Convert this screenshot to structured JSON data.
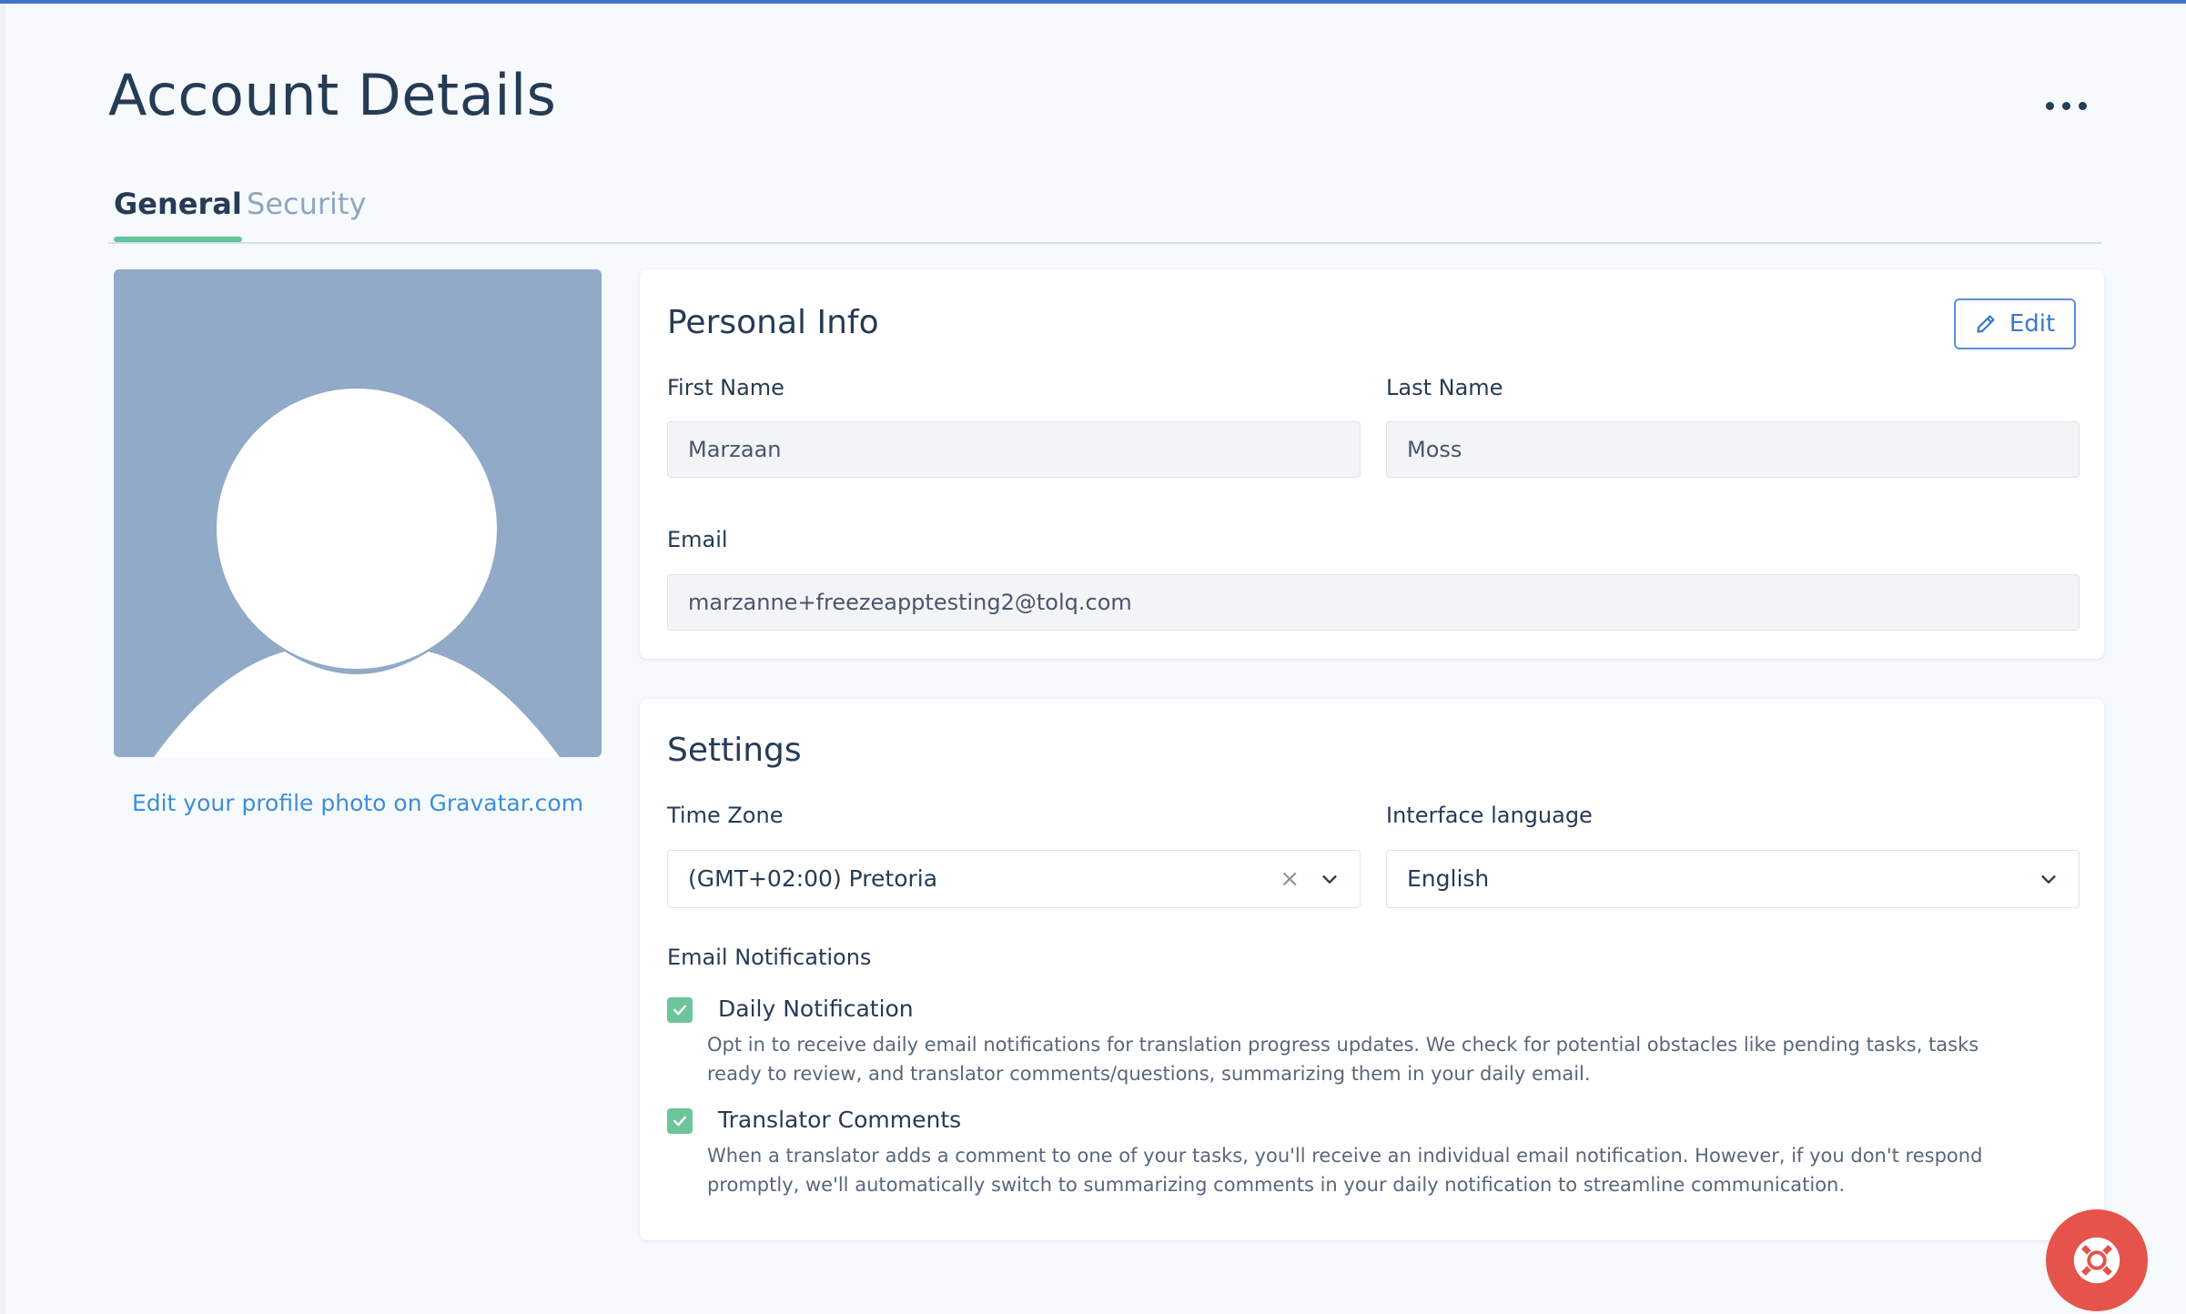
{
  "page": {
    "title": "Account Details",
    "more_icon": "more-horizontal-icon"
  },
  "tabs": [
    {
      "label": "General",
      "active": true
    },
    {
      "label": "Security",
      "active": false
    }
  ],
  "profile": {
    "avatar_icon": "default-user-avatar-icon",
    "gravatar_link": "Edit your profile photo on Gravatar.com"
  },
  "personal_info": {
    "title": "Personal Info",
    "edit_label": "Edit",
    "edit_icon": "pencil-icon",
    "first_name_label": "First Name",
    "first_name": "Marzaan",
    "last_name_label": "Last Name",
    "last_name": "Moss",
    "email_label": "Email",
    "email": "marzanne+freezeapptesting2@tolq.com"
  },
  "settings": {
    "title": "Settings",
    "timezone_label": "Time Zone",
    "timezone": "(GMT+02:00) Pretoria",
    "clear_glyph": "×",
    "language_label": "Interface language",
    "language": "English",
    "email_notifications_label": "Email Notifications",
    "notifications": [
      {
        "label": "Daily Notification",
        "checked": true,
        "description": "Opt in to receive daily email notifications for translation progress updates. We check for potential obstacles like pending tasks, tasks ready to review, and translator comments/questions, summarizing them in your daily email."
      },
      {
        "label": "Translator Comments",
        "checked": true,
        "description": "When a translator adds a comment to one of your tasks, you'll receive an individual email notification. However, if you don't respond promptly, we'll automatically switch to summarizing comments in your daily notification to streamline communication."
      }
    ]
  },
  "colors": {
    "accent": "#3b78cc",
    "tab_underline": "#5ec49a",
    "checkbox": "#6bc49a",
    "help_button": "#e5534b",
    "avatar_bg": "#90aac8"
  },
  "help": {
    "icon": "lifebuoy-icon"
  }
}
